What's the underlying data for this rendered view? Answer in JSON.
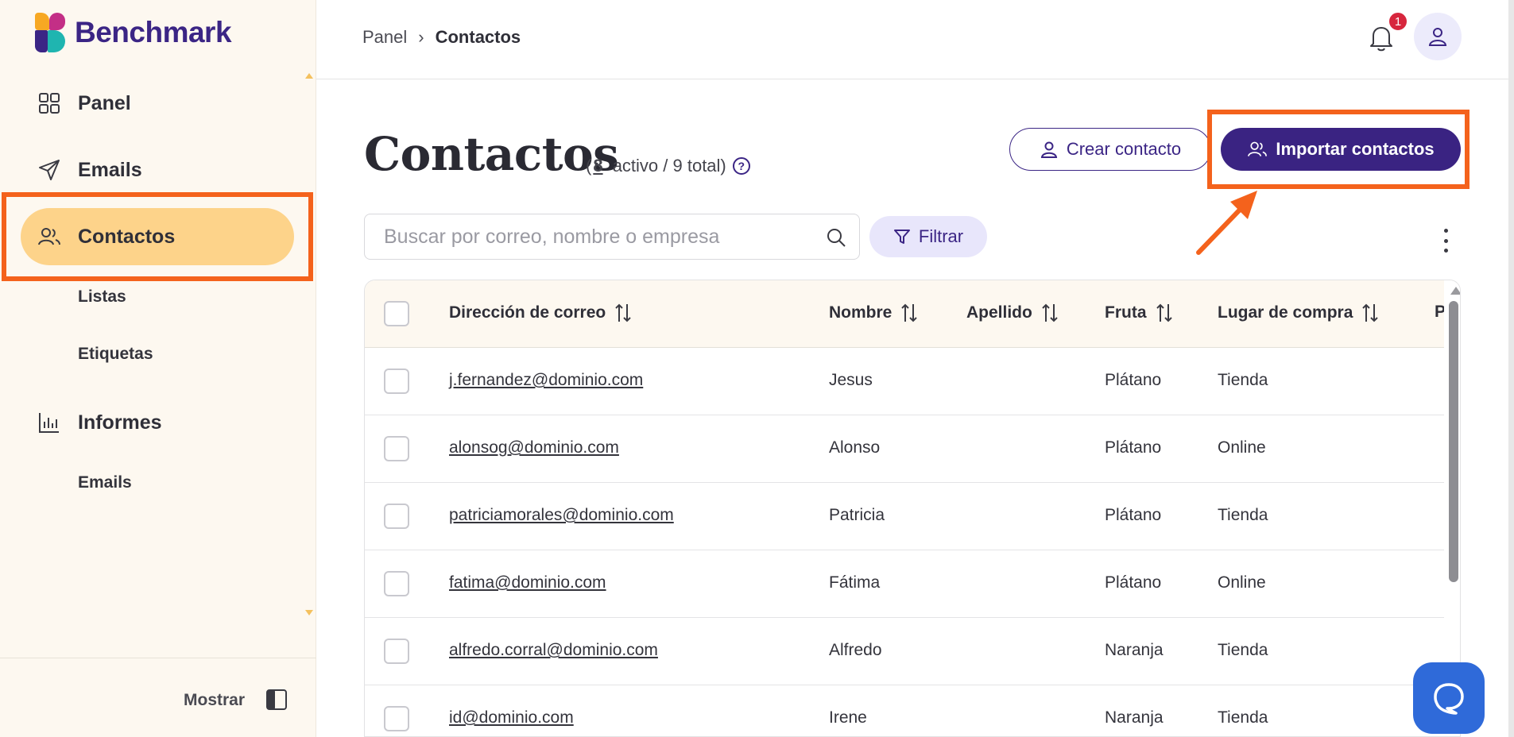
{
  "brand": {
    "name": "Benchmark",
    "colors": {
      "purple": "#3b2585",
      "orange": "#f4621c",
      "sidebar_bg": "#fdf8f0",
      "active_nav": "#fdd38a"
    }
  },
  "sidebar": {
    "items": [
      {
        "label": "Panel",
        "icon": "grid-icon"
      },
      {
        "label": "Emails",
        "icon": "send-icon"
      },
      {
        "label": "Contactos",
        "icon": "users-icon",
        "active": true
      },
      {
        "label": "Informes",
        "icon": "bar-chart-icon"
      }
    ],
    "subitems": {
      "contactos": [
        {
          "label": "Listas"
        },
        {
          "label": "Etiquetas"
        }
      ],
      "informes": [
        {
          "label": "Emails"
        }
      ]
    },
    "footer": {
      "toggle_label": "Mostrar"
    }
  },
  "topbar": {
    "breadcrumb": [
      "Panel",
      "Contactos"
    ],
    "notifications_count": "1"
  },
  "page": {
    "title": "Contactos",
    "count_open": "(",
    "active_count": "8",
    "count_rest": " activo / 9 total)",
    "create_button": "Crear contacto",
    "import_button": "Importar contactos"
  },
  "search": {
    "placeholder": "Buscar por correo, nombre o empresa",
    "filter_label": "Filtrar"
  },
  "table": {
    "columns": [
      "Dirección de correo",
      "Nombre",
      "Apellido",
      "Fruta",
      "Lugar de compra",
      "P"
    ],
    "rows": [
      {
        "email": "j.fernandez@dominio.com",
        "nombre": "Jesus",
        "apellido": "",
        "fruta": "Plátano",
        "lugar": "Tienda"
      },
      {
        "email": "alonsog@dominio.com",
        "nombre": "Alonso",
        "apellido": "",
        "fruta": "Plátano",
        "lugar": "Online"
      },
      {
        "email": "patriciamorales@dominio.com",
        "nombre": "Patricia",
        "apellido": "",
        "fruta": "Plátano",
        "lugar": "Tienda"
      },
      {
        "email": "fatima@dominio.com",
        "nombre": "Fátima",
        "apellido": "",
        "fruta": "Plátano",
        "lugar": "Online"
      },
      {
        "email": "alfredo.corral@dominio.com",
        "nombre": "Alfredo",
        "apellido": "",
        "fruta": "Naranja",
        "lugar": "Tienda"
      },
      {
        "email": "id@dominio.com",
        "nombre": "Irene",
        "apellido": "",
        "fruta": "Naranja",
        "lugar": "Tienda"
      }
    ]
  }
}
